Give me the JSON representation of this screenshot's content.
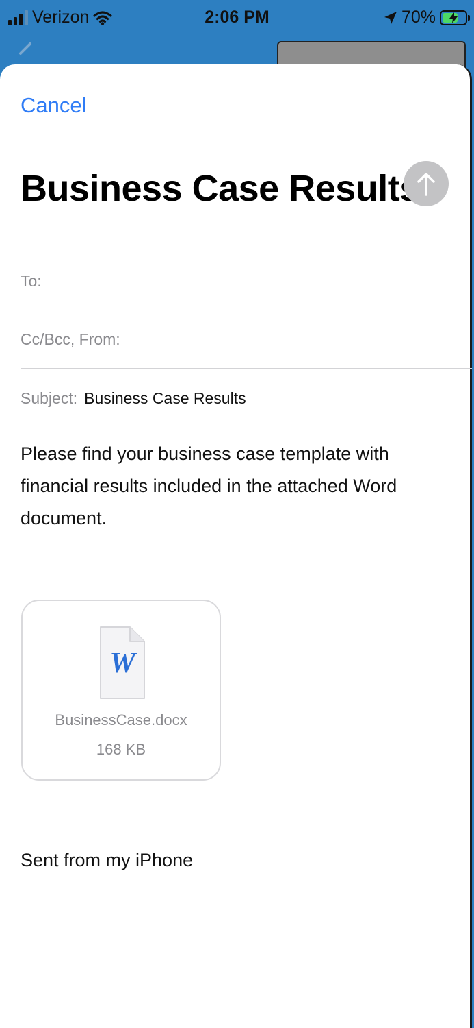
{
  "status_bar": {
    "carrier": "Verizon",
    "time": "2:06 PM",
    "battery_percent": "70%",
    "battery_level": 0.7,
    "icons": [
      "signal-icon",
      "wifi-icon",
      "location-arrow-icon",
      "battery-charging-icon"
    ]
  },
  "compose": {
    "cancel_label": "Cancel",
    "title": "Business Case Results",
    "send_icon": "arrow-up-icon",
    "send_color": "#c3c3c5",
    "accent_color": "#2f7cf6",
    "to_label": "To:",
    "cc_label": "Cc/Bcc, From:",
    "subject_label": "Subject:",
    "subject_value": "Business Case Results",
    "body": "Please find your business case template with financial results included in the attached Word document.",
    "attachment": {
      "icon": "word-document-icon",
      "glyph": "W",
      "name": "BusinessCase.docx",
      "size": "168 KB"
    },
    "signature": "Sent from my iPhone"
  }
}
